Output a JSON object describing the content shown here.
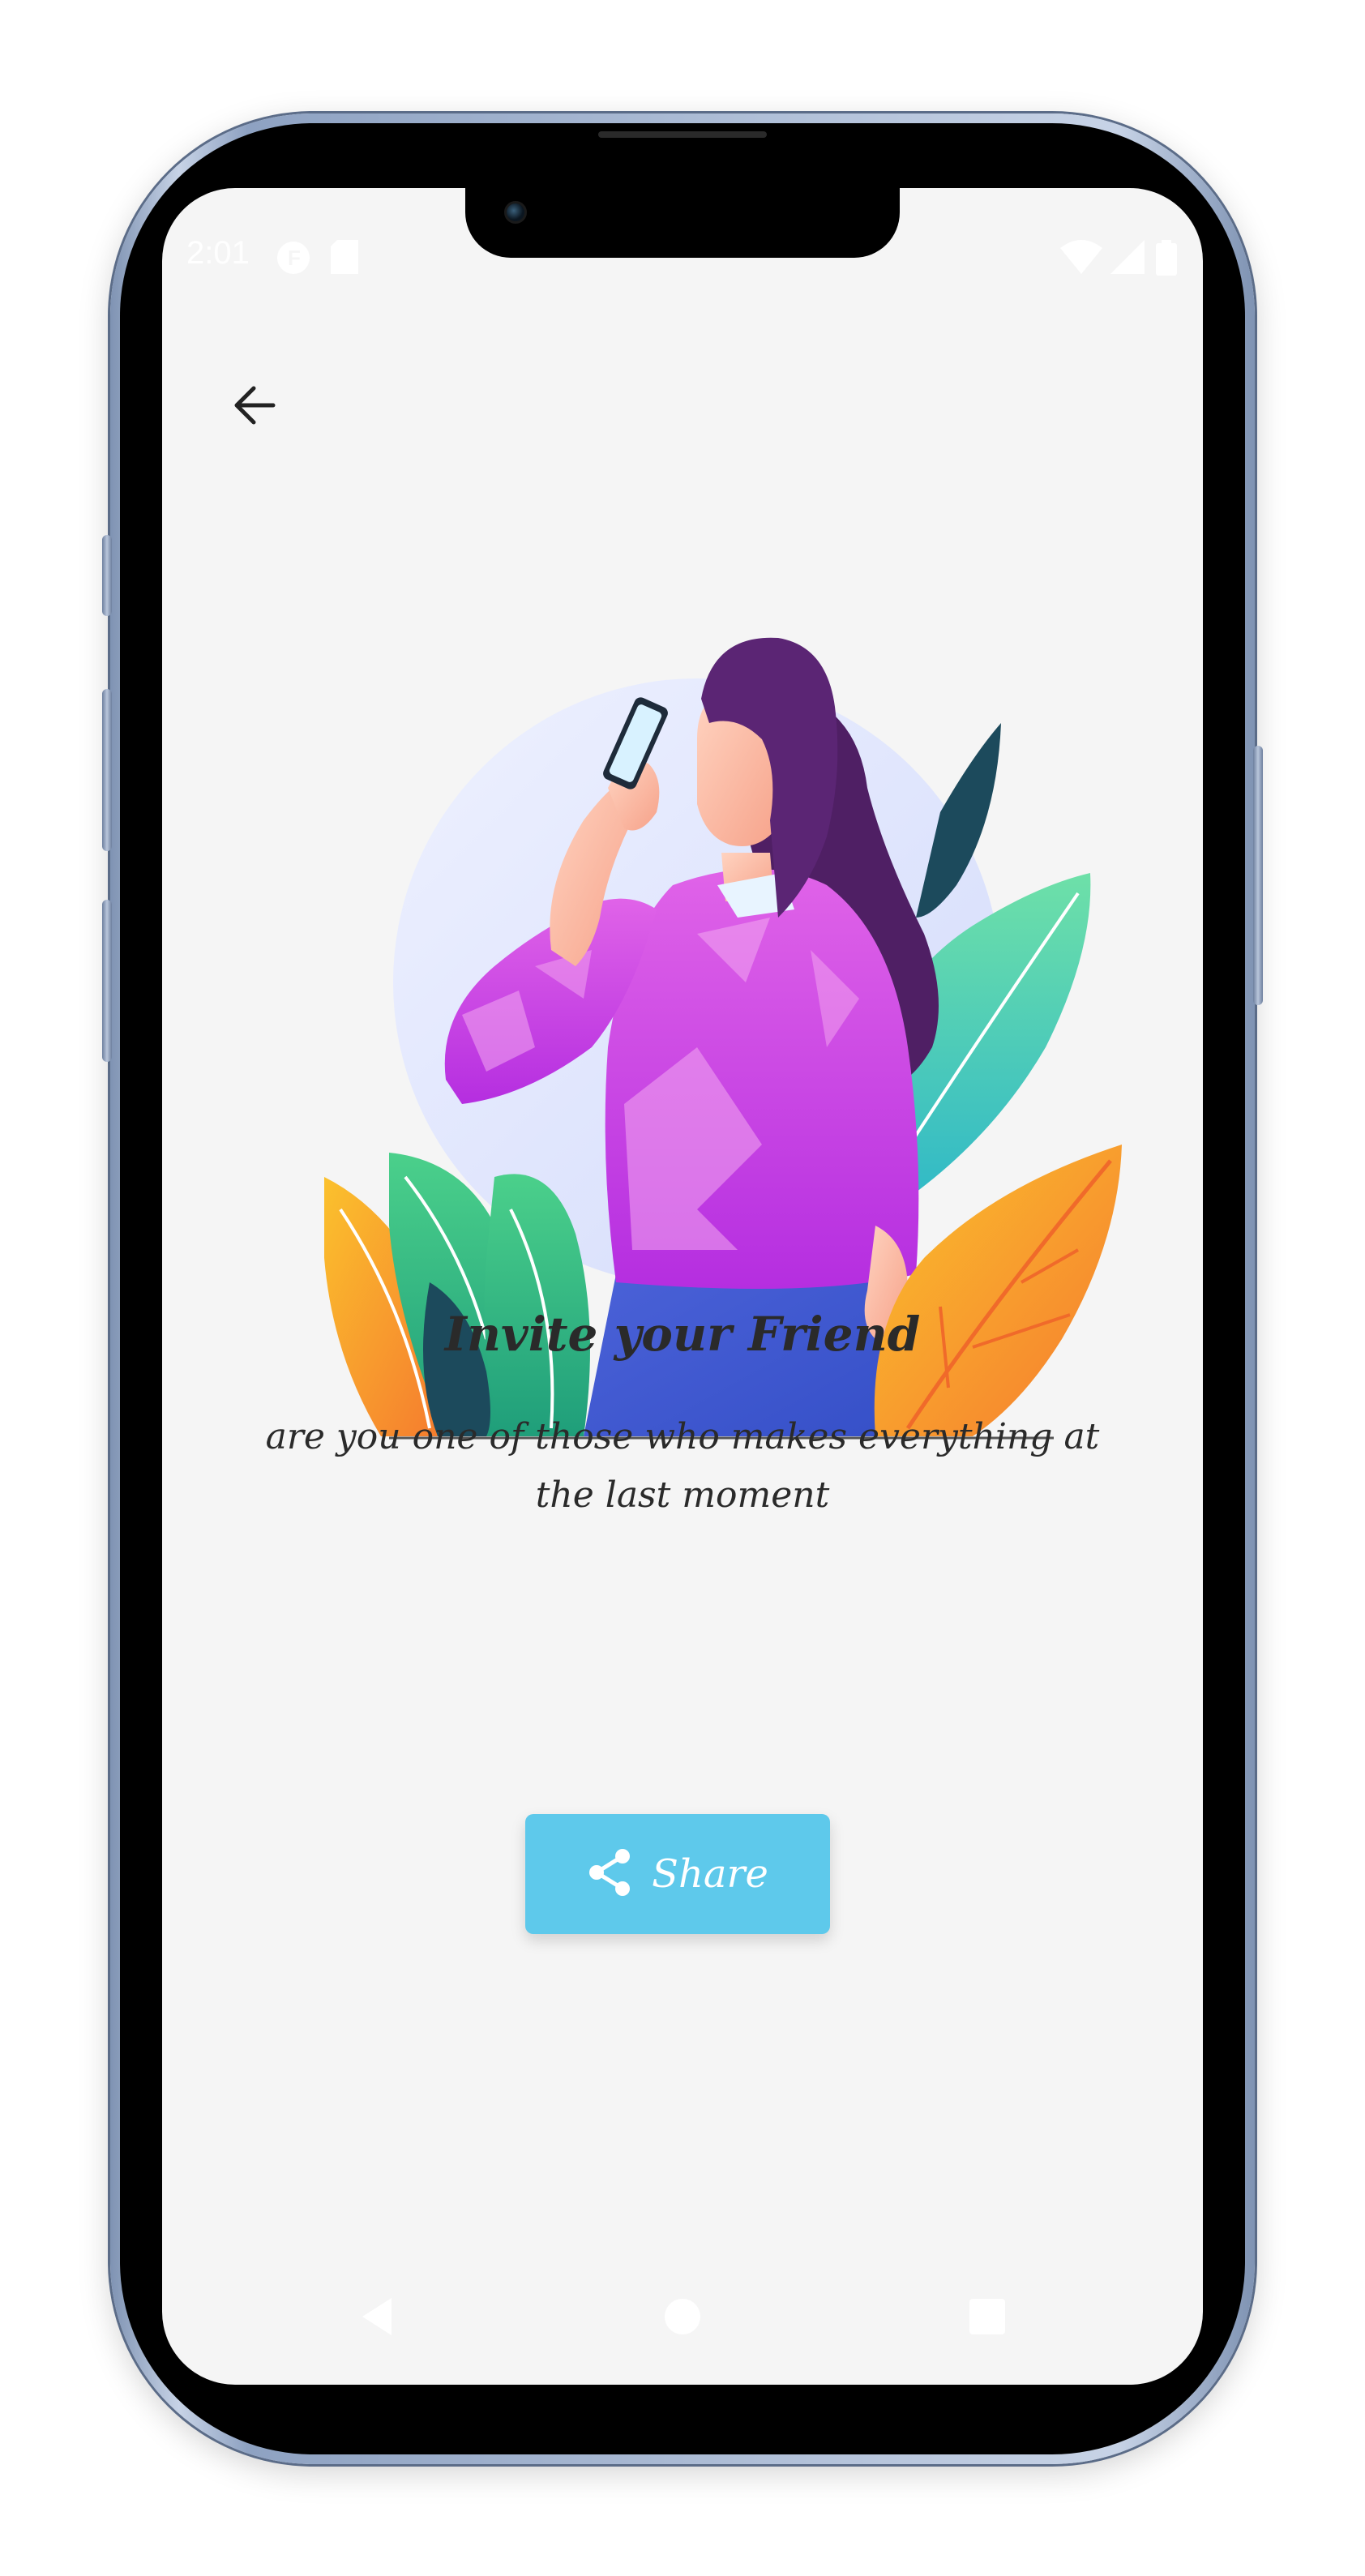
{
  "status_bar": {
    "time": "2:01"
  },
  "content": {
    "title": "Invite your Friend",
    "subtitle": "are you one of those who makes everything at the last moment"
  },
  "actions": {
    "share_label": "Share"
  },
  "icons": {
    "back": "arrow-left-icon",
    "share": "share-icon",
    "nav_back": "triangle-back-icon",
    "nav_home": "circle-home-icon",
    "nav_recents": "square-recents-icon"
  },
  "colors": {
    "screen_background": "#f5f5f5",
    "share_button": "#5ec9eb",
    "text": "#2a2a2a"
  }
}
